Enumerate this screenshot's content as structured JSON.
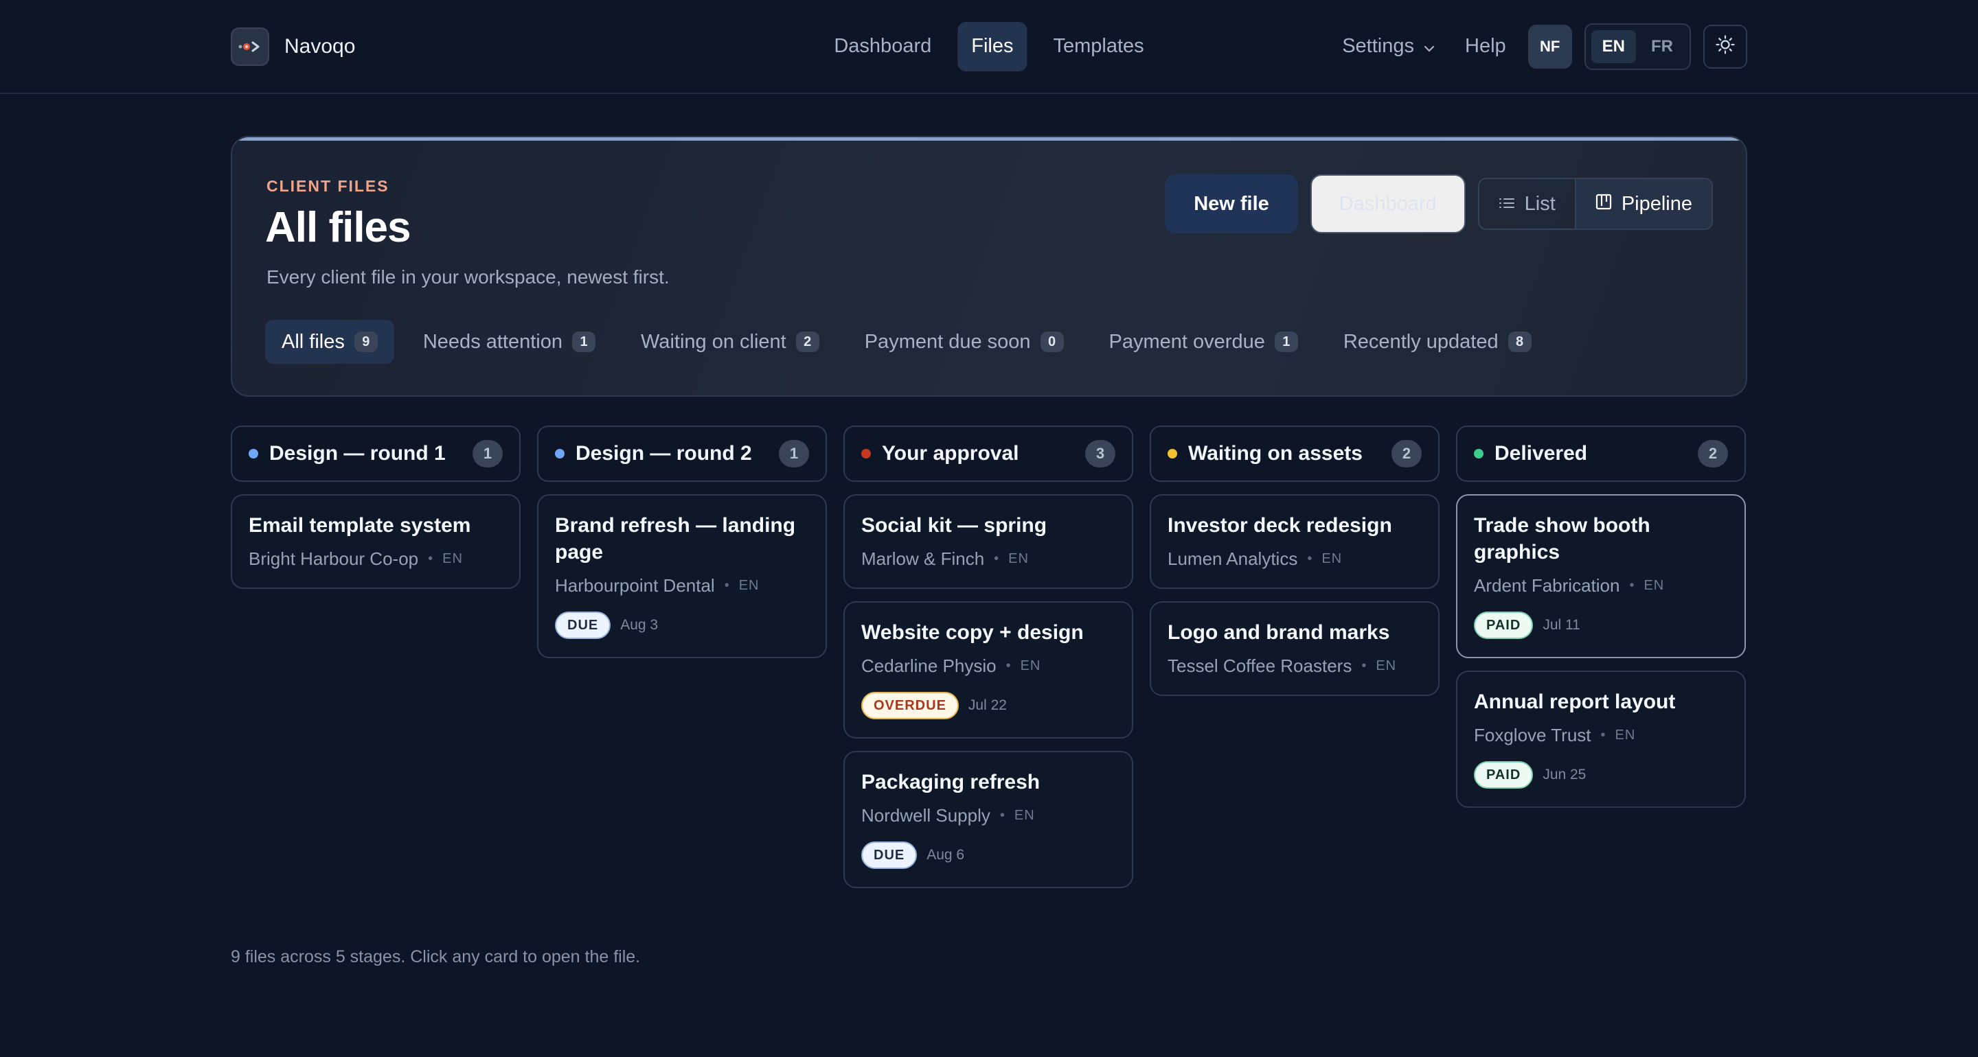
{
  "brand": {
    "name": "Navoqo"
  },
  "nav": {
    "items": [
      {
        "label": "Dashboard",
        "active": false
      },
      {
        "label": "Files",
        "active": true
      },
      {
        "label": "Templates",
        "active": false
      }
    ],
    "settings_label": "Settings",
    "help_label": "Help",
    "avatar_initials": "NF",
    "languages": [
      {
        "label": "EN",
        "active": true
      },
      {
        "label": "FR",
        "active": false
      }
    ]
  },
  "hero": {
    "eyebrow": "CLIENT FILES",
    "title": "All files",
    "subtitle": "Every client file in your workspace, newest first.",
    "new_file_label": "New file",
    "dashboard_label": "Dashboard",
    "view_list_label": "List",
    "view_pipeline_label": "Pipeline",
    "active_view": "Pipeline"
  },
  "filters": [
    {
      "label": "All files",
      "count": "9",
      "active": true
    },
    {
      "label": "Needs attention",
      "count": "1",
      "active": false
    },
    {
      "label": "Waiting on client",
      "count": "2",
      "active": false
    },
    {
      "label": "Payment due soon",
      "count": "0",
      "active": false
    },
    {
      "label": "Payment overdue",
      "count": "1",
      "active": false
    },
    {
      "label": "Recently updated",
      "count": "8",
      "active": false
    }
  ],
  "columns": [
    {
      "title": "Design — round 1",
      "count": "1",
      "color": "#6ea8f5",
      "cards": [
        {
          "title": "Email template system",
          "client": "Bright Harbour Co-op",
          "lang": "EN"
        }
      ]
    },
    {
      "title": "Design — round 2",
      "count": "1",
      "color": "#6ea8f5",
      "cards": [
        {
          "title": "Brand refresh — landing page",
          "client": "Harbourpoint Dental",
          "lang": "EN",
          "badge": "DUE",
          "badge_type": "due",
          "date": "Aug 3"
        }
      ]
    },
    {
      "title": "Your approval",
      "count": "3",
      "color": "#c33a22",
      "cards": [
        {
          "title": "Social kit — spring",
          "client": "Marlow & Finch",
          "lang": "EN"
        },
        {
          "title": "Website copy + design",
          "client": "Cedarline Physio",
          "lang": "EN",
          "badge": "OVERDUE",
          "badge_type": "overdue",
          "date": "Jul 22"
        },
        {
          "title": "Packaging refresh",
          "client": "Nordwell Supply",
          "lang": "EN",
          "badge": "DUE",
          "badge_type": "due",
          "date": "Aug 6"
        }
      ]
    },
    {
      "title": "Waiting on assets",
      "count": "2",
      "color": "#f2c230",
      "cards": [
        {
          "title": "Investor deck redesign",
          "client": "Lumen Analytics",
          "lang": "EN"
        },
        {
          "title": "Logo and brand marks",
          "client": "Tessel Coffee Roasters",
          "lang": "EN"
        }
      ]
    },
    {
      "title": "Delivered",
      "count": "2",
      "color": "#3ccf8e",
      "cards": [
        {
          "title": "Trade show booth graphics",
          "client": "Ardent Fabrication",
          "lang": "EN",
          "badge": "PAID",
          "badge_type": "paid",
          "date": "Jul 11",
          "highlight": true
        },
        {
          "title": "Annual report layout",
          "client": "Foxglove Trust",
          "lang": "EN",
          "badge": "PAID",
          "badge_type": "paid",
          "date": "Jun 25"
        }
      ]
    }
  ],
  "footer_note": "9 files across 5 stages. Click any card to open the file.",
  "icons": {
    "logo": "navoqo-logo-icon",
    "settings_chevron": "chevron-down-icon",
    "theme": "sun-icon",
    "list": "list-icon",
    "pipeline": "pipeline-icon"
  }
}
